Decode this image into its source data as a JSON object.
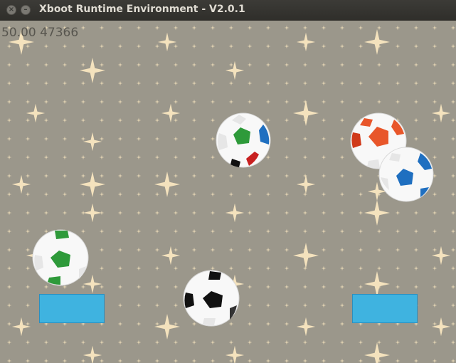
{
  "window": {
    "title": "Xboot Runtime Environment - V2.0.1",
    "close_glyph": "×",
    "minimize_glyph": "–"
  },
  "game": {
    "fps_text": "50.00 47366",
    "background_color": "#9b978b",
    "star_color": "#f4e2bd",
    "paddle_color": "#3fb3e0",
    "balls": [
      {
        "name": "ball-green-top",
        "color": "#2e9a3a"
      },
      {
        "name": "ball-orange",
        "color": "#e8562a"
      },
      {
        "name": "ball-blue",
        "color": "#1f6fc0"
      },
      {
        "name": "ball-green-left",
        "color": "#2e9a3a"
      },
      {
        "name": "ball-black",
        "color": "#111111"
      }
    ]
  }
}
